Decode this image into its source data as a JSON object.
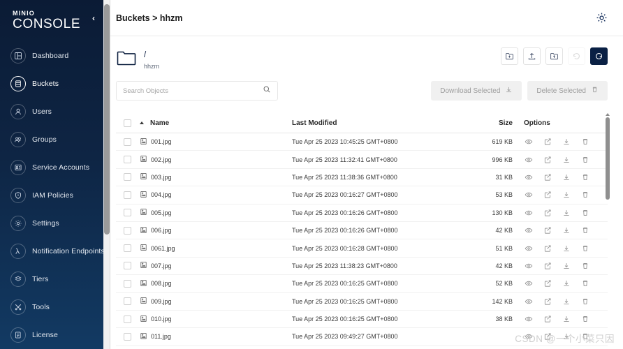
{
  "sidebar": {
    "brand_top": "MINIO",
    "brand_bottom": "CONSOLE",
    "collapse_label": "‹",
    "items": [
      {
        "label": "Dashboard",
        "icon": "dashboard-icon",
        "active": false
      },
      {
        "label": "Buckets",
        "icon": "buckets-icon",
        "active": true
      },
      {
        "label": "Users",
        "icon": "user-icon",
        "active": false
      },
      {
        "label": "Groups",
        "icon": "groups-icon",
        "active": false
      },
      {
        "label": "Service Accounts",
        "icon": "service-accounts-icon",
        "active": false
      },
      {
        "label": "IAM Policies",
        "icon": "shield-icon",
        "active": false
      },
      {
        "label": "Settings",
        "icon": "gear-icon",
        "active": false
      },
      {
        "label": "Notification Endpoints",
        "icon": "lambda-icon",
        "active": false
      },
      {
        "label": "Tiers",
        "icon": "tiers-icon",
        "active": false
      },
      {
        "label": "Tools",
        "icon": "tools-icon",
        "active": false
      },
      {
        "label": "License",
        "icon": "license-icon",
        "active": false
      }
    ]
  },
  "header": {
    "breadcrumb": "Buckets > hhzm",
    "settings_icon": "gear-icon"
  },
  "path": {
    "folder_icon": "folder-icon",
    "separator": "/",
    "bucket_name": "hhzm"
  },
  "actions": [
    {
      "name": "create-new-path-button",
      "icon": "folder-plus-icon",
      "disabled": false,
      "primary": false
    },
    {
      "name": "upload-file-button",
      "icon": "upload-icon",
      "disabled": false,
      "primary": false
    },
    {
      "name": "upload-folder-button",
      "icon": "folder-upload-icon",
      "disabled": false,
      "primary": false
    },
    {
      "name": "rewind-button",
      "icon": "rewind-icon",
      "disabled": true,
      "primary": false
    },
    {
      "name": "refresh-button",
      "icon": "refresh-icon",
      "disabled": false,
      "primary": true
    }
  ],
  "search": {
    "placeholder": "Search Objects",
    "value": "",
    "icon": "search-icon"
  },
  "selection_buttons": [
    {
      "label": "Download Selected",
      "icon": "download-icon",
      "disabled": true
    },
    {
      "label": "Delete Selected",
      "icon": "trash-icon",
      "disabled": true
    }
  ],
  "table": {
    "columns": {
      "name": "Name",
      "last_modified": "Last Modified",
      "size": "Size",
      "options": "Options"
    },
    "sort": {
      "column": "Name",
      "direction": "asc"
    },
    "row_icon": "image-file-icon",
    "row_actions": [
      {
        "name": "preview-icon",
        "title": "preview"
      },
      {
        "name": "share-icon",
        "title": "share"
      },
      {
        "name": "download-icon",
        "title": "download"
      },
      {
        "name": "delete-icon",
        "title": "delete"
      }
    ],
    "rows": [
      {
        "name": "001.jpg",
        "modified": "Tue Apr 25 2023 10:45:25 GMT+0800",
        "size": "619 KB"
      },
      {
        "name": "002.jpg",
        "modified": "Tue Apr 25 2023 11:32:41 GMT+0800",
        "size": "996 KB"
      },
      {
        "name": "003.jpg",
        "modified": "Tue Apr 25 2023 11:38:36 GMT+0800",
        "size": "31 KB"
      },
      {
        "name": "004.jpg",
        "modified": "Tue Apr 25 2023 00:16:27 GMT+0800",
        "size": "53 KB"
      },
      {
        "name": "005.jpg",
        "modified": "Tue Apr 25 2023 00:16:26 GMT+0800",
        "size": "130 KB"
      },
      {
        "name": "006.jpg",
        "modified": "Tue Apr 25 2023 00:16:26 GMT+0800",
        "size": "42 KB"
      },
      {
        "name": "0061.jpg",
        "modified": "Tue Apr 25 2023 00:16:28 GMT+0800",
        "size": "51 KB"
      },
      {
        "name": "007.jpg",
        "modified": "Tue Apr 25 2023 11:38:23 GMT+0800",
        "size": "42 KB"
      },
      {
        "name": "008.jpg",
        "modified": "Tue Apr 25 2023 00:16:25 GMT+0800",
        "size": "52 KB"
      },
      {
        "name": "009.jpg",
        "modified": "Tue Apr 25 2023 00:16:25 GMT+0800",
        "size": "142 KB"
      },
      {
        "name": "010.jpg",
        "modified": "Tue Apr 25 2023 00:16:25 GMT+0800",
        "size": "38 KB"
      },
      {
        "name": "011.jpg",
        "modified": "Tue Apr 25 2023 09:49:27 GMT+0800",
        "size": ""
      }
    ]
  },
  "watermark": "CSDN @一个小菜只因",
  "colors": {
    "sidebar_top": "#0b1b35",
    "sidebar_bottom": "#123a63",
    "primary": "#0a2044",
    "disabled_button_bg": "#f0f0f0"
  }
}
